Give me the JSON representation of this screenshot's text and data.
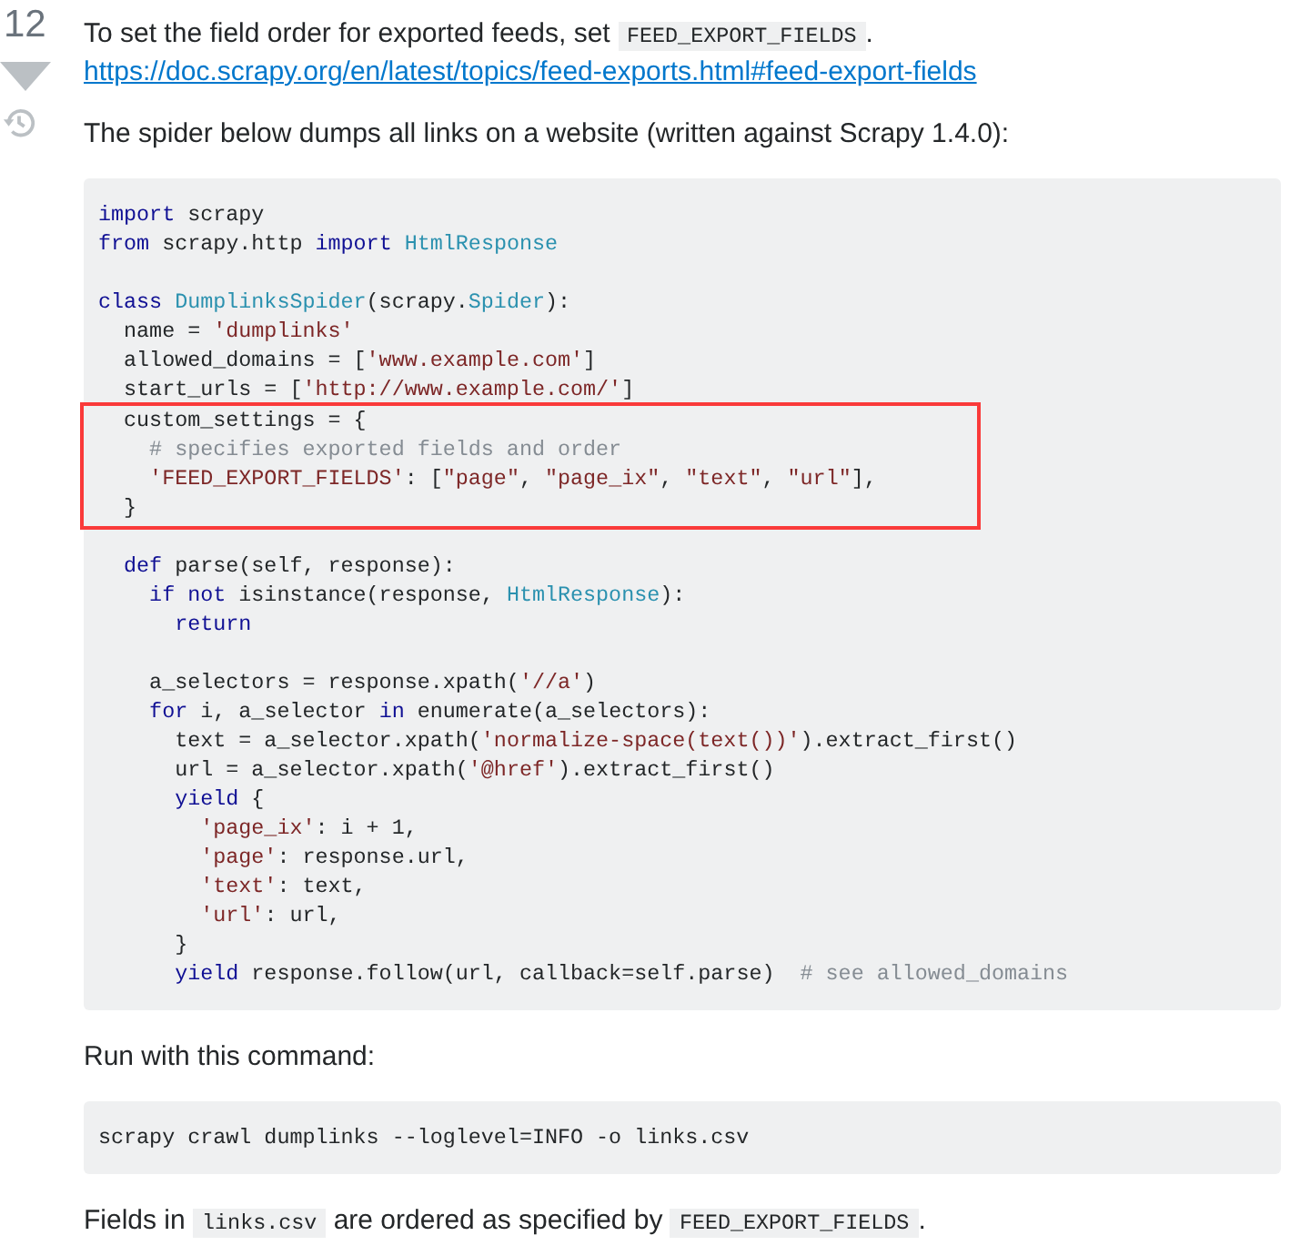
{
  "vote": {
    "score": "12",
    "downvoted": false
  },
  "paragraphs_top": [
    {
      "segments": [
        {
          "kind": "text",
          "text": "To set the field order for exported feeds, set "
        },
        {
          "kind": "code",
          "text": "FEED_EXPORT_FIELDS"
        },
        {
          "kind": "text",
          "text": "."
        }
      ]
    },
    {
      "segments": [
        {
          "kind": "link",
          "text": "https://doc.scrapy.org/en/latest/topics/feed-exports.html#feed-export-fields"
        }
      ]
    },
    {
      "segments": [
        {
          "kind": "text",
          "text": "The spider below dumps all links on a website (written against Scrapy 1.4.0):"
        }
      ]
    }
  ],
  "code_block": {
    "lines": [
      {
        "highlighted": false,
        "tokens": [
          {
            "kind": "kw",
            "text": "import"
          },
          {
            "kind": "plain",
            "text": " scrapy"
          }
        ]
      },
      {
        "highlighted": false,
        "tokens": [
          {
            "kind": "kw",
            "text": "from"
          },
          {
            "kind": "plain",
            "text": " scrapy.http "
          },
          {
            "kind": "kw",
            "text": "import"
          },
          {
            "kind": "type",
            "text": " HtmlResponse"
          }
        ]
      },
      {
        "highlighted": false
      },
      {
        "highlighted": false,
        "tokens": [
          {
            "kind": "kw",
            "text": "class"
          },
          {
            "kind": "type",
            "text": " DumplinksSpider"
          },
          {
            "kind": "plain",
            "text": "(scrapy."
          },
          {
            "kind": "type",
            "text": "Spider"
          },
          {
            "kind": "plain",
            "text": "):"
          }
        ]
      },
      {
        "highlighted": false,
        "tokens": [
          {
            "kind": "plain",
            "text": "  name = "
          },
          {
            "kind": "str",
            "text": "'dumplinks'"
          }
        ]
      },
      {
        "highlighted": false,
        "tokens": [
          {
            "kind": "plain",
            "text": "  allowed_domains = ["
          },
          {
            "kind": "str",
            "text": "'www.example.com'"
          },
          {
            "kind": "plain",
            "text": "]"
          }
        ]
      },
      {
        "highlighted": false,
        "tokens": [
          {
            "kind": "plain",
            "text": "  start_urls = ["
          },
          {
            "kind": "str",
            "text": "'http://www.example.com/'"
          },
          {
            "kind": "plain",
            "text": "]"
          }
        ]
      },
      {
        "highlighted": true,
        "tokens": [
          {
            "kind": "plain",
            "text": "  custom_settings = {"
          }
        ]
      },
      {
        "highlighted": true,
        "tokens": [
          {
            "kind": "com",
            "text": "    # specifies exported fields and order"
          }
        ]
      },
      {
        "highlighted": true,
        "tokens": [
          {
            "kind": "str",
            "text": "    'FEED_EXPORT_FIELDS'"
          },
          {
            "kind": "plain",
            "text": ": ["
          },
          {
            "kind": "str",
            "text": "\"page\""
          },
          {
            "kind": "plain",
            "text": ", "
          },
          {
            "kind": "str",
            "text": "\"page_ix\""
          },
          {
            "kind": "plain",
            "text": ", "
          },
          {
            "kind": "str",
            "text": "\"text\""
          },
          {
            "kind": "plain",
            "text": ", "
          },
          {
            "kind": "str",
            "text": "\"url\""
          },
          {
            "kind": "plain",
            "text": "],"
          }
        ]
      },
      {
        "highlighted": true,
        "tokens": [
          {
            "kind": "plain",
            "text": "  }"
          }
        ]
      },
      {
        "highlighted": false
      },
      {
        "highlighted": false,
        "tokens": [
          {
            "kind": "kw",
            "text": "  def"
          },
          {
            "kind": "plain",
            "text": " parse(self, response):"
          }
        ]
      },
      {
        "highlighted": false,
        "tokens": [
          {
            "kind": "kw",
            "text": "    if not"
          },
          {
            "kind": "plain",
            "text": " isinstance(response, "
          },
          {
            "kind": "type",
            "text": "HtmlResponse"
          },
          {
            "kind": "plain",
            "text": "):"
          }
        ]
      },
      {
        "highlighted": false,
        "tokens": [
          {
            "kind": "kw",
            "text": "      return"
          }
        ]
      },
      {
        "highlighted": false
      },
      {
        "highlighted": false,
        "tokens": [
          {
            "kind": "plain",
            "text": "    a_selectors = response.xpath("
          },
          {
            "kind": "str",
            "text": "'//a'"
          },
          {
            "kind": "plain",
            "text": ")"
          }
        ]
      },
      {
        "highlighted": false,
        "tokens": [
          {
            "kind": "kw",
            "text": "    for"
          },
          {
            "kind": "plain",
            "text": " i, a_selector "
          },
          {
            "kind": "kw",
            "text": "in"
          },
          {
            "kind": "plain",
            "text": " enumerate(a_selectors):"
          }
        ]
      },
      {
        "highlighted": false,
        "tokens": [
          {
            "kind": "plain",
            "text": "      text = a_selector.xpath("
          },
          {
            "kind": "str",
            "text": "'normalize-space(text())'"
          },
          {
            "kind": "plain",
            "text": ").extract_first()"
          }
        ]
      },
      {
        "highlighted": false,
        "tokens": [
          {
            "kind": "plain",
            "text": "      url = a_selector.xpath("
          },
          {
            "kind": "str",
            "text": "'@href'"
          },
          {
            "kind": "plain",
            "text": ").extract_first()"
          }
        ]
      },
      {
        "highlighted": false,
        "tokens": [
          {
            "kind": "kw",
            "text": "      yield"
          },
          {
            "kind": "plain",
            "text": " {"
          }
        ]
      },
      {
        "highlighted": false,
        "tokens": [
          {
            "kind": "str",
            "text": "        'page_ix'"
          },
          {
            "kind": "plain",
            "text": ": i + 1,"
          }
        ]
      },
      {
        "highlighted": false,
        "tokens": [
          {
            "kind": "str",
            "text": "        'page'"
          },
          {
            "kind": "plain",
            "text": ": response.url,"
          }
        ]
      },
      {
        "highlighted": false,
        "tokens": [
          {
            "kind": "str",
            "text": "        'text'"
          },
          {
            "kind": "plain",
            "text": ": text,"
          }
        ]
      },
      {
        "highlighted": false,
        "tokens": [
          {
            "kind": "str",
            "text": "        'url'"
          },
          {
            "kind": "plain",
            "text": ": url,"
          }
        ]
      },
      {
        "highlighted": false,
        "tokens": [
          {
            "kind": "plain",
            "text": "      }"
          }
        ]
      },
      {
        "highlighted": false,
        "tokens": [
          {
            "kind": "kw",
            "text": "      yield"
          },
          {
            "kind": "plain",
            "text": " response.follow(url, callback=self.parse)  "
          },
          {
            "kind": "com",
            "text": "# see allowed_domains"
          }
        ]
      }
    ]
  },
  "paragraph_mid": {
    "segments": [
      {
        "kind": "text",
        "text": "Run with this command:"
      }
    ]
  },
  "command_block": {
    "lines": [
      {
        "highlighted": false,
        "tokens": [
          {
            "kind": "plain",
            "text": "scrapy crawl dumplinks --loglevel=INFO -o links.csv"
          }
        ]
      }
    ]
  },
  "paragraph_end": {
    "segments": [
      {
        "kind": "text",
        "text": "Fields in "
      },
      {
        "kind": "code",
        "text": "links.csv"
      },
      {
        "kind": "text",
        "text": " are ordered as specified by "
      },
      {
        "kind": "code",
        "text": "FEED_EXPORT_FIELDS"
      },
      {
        "kind": "text",
        "text": "."
      }
    ]
  }
}
